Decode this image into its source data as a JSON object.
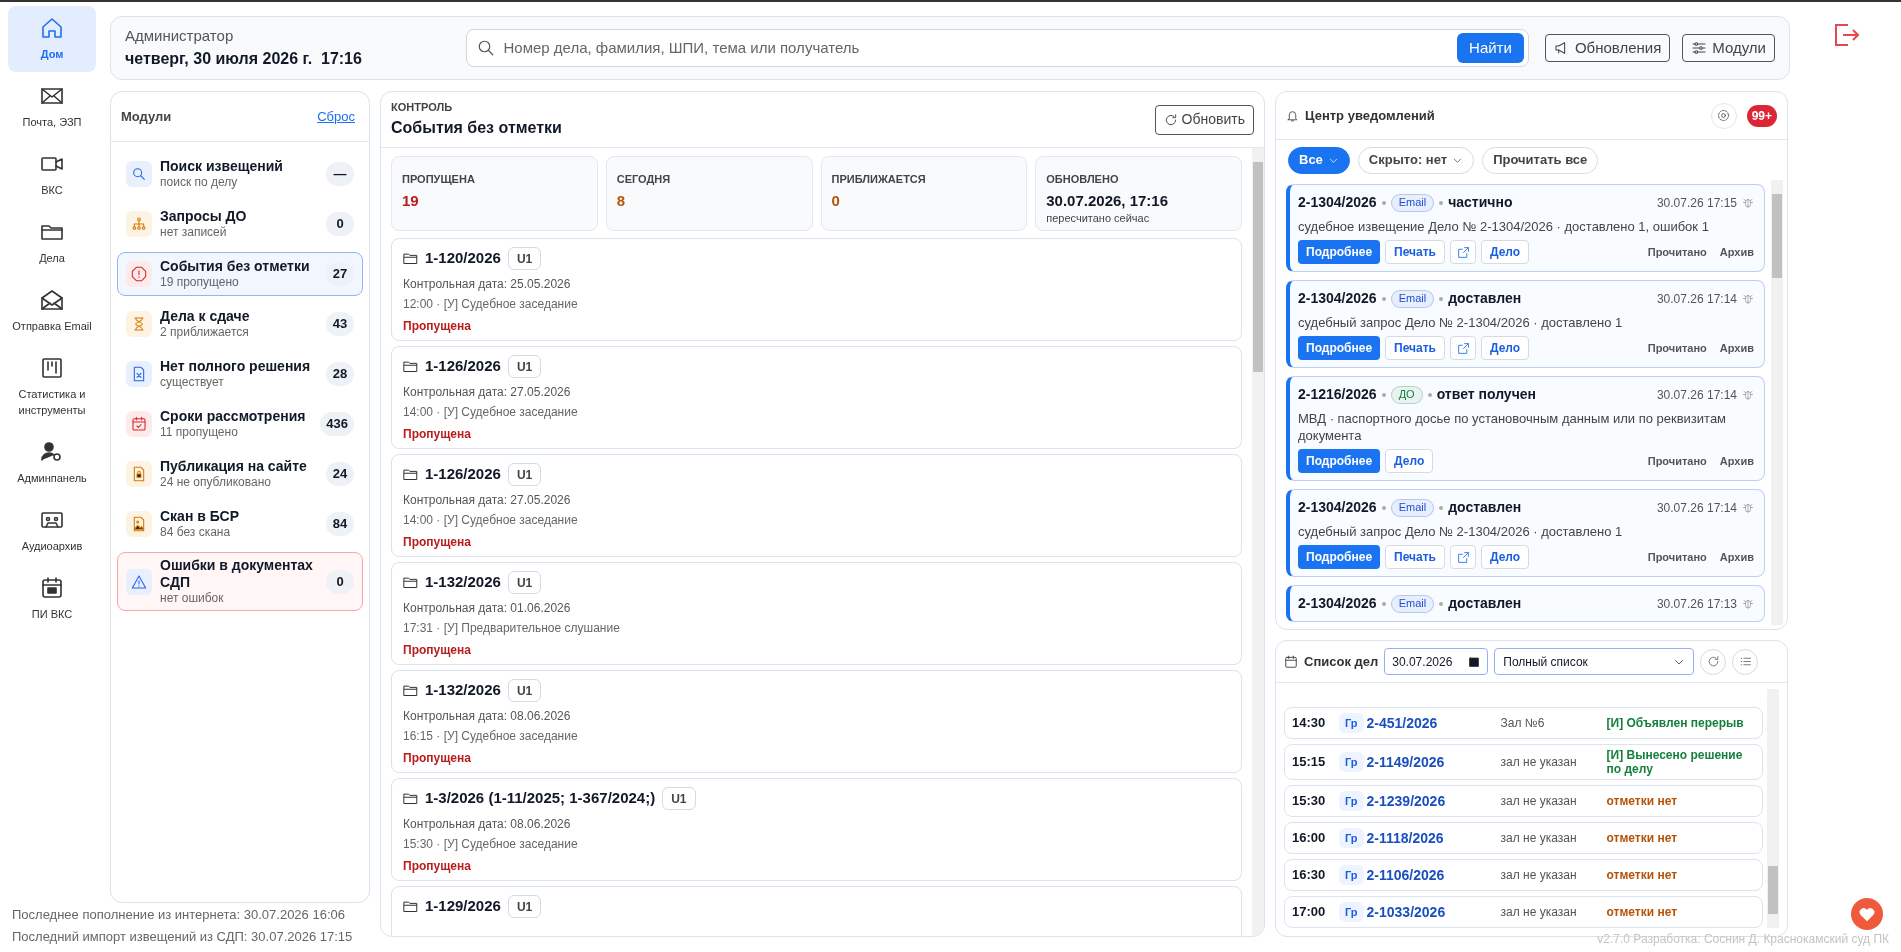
{
  "nav": [
    {
      "label": "Дом",
      "selected": true
    },
    {
      "label": "Почта, ЭЗП",
      "selected": false
    },
    {
      "label": "ВКС",
      "selected": false
    },
    {
      "label": "Дела",
      "selected": false
    },
    {
      "label": "Отправка Email",
      "selected": false
    },
    {
      "label": "Статистика и инструменты",
      "selected": false
    },
    {
      "label": "Админпанель",
      "selected": false
    },
    {
      "label": "Аудиоархив",
      "selected": false
    },
    {
      "label": "ПИ ВКС",
      "selected": false
    }
  ],
  "header": {
    "user": "Администратор",
    "datetime": "четверг, 30 июля 2026 г.  17:16",
    "search_placeholder": "Номер дела, фамилия, ШПИ, тема или получатель",
    "search_button": "Найти",
    "buttons": [
      "Обновления",
      "Модули"
    ]
  },
  "modules": {
    "title": "Модули",
    "reset": "Сброс",
    "items": [
      {
        "title": "Поиск извещений",
        "subtitle": "поиск по делу",
        "count": "—",
        "selected": false,
        "alert": false
      },
      {
        "title": "Запросы ДО",
        "subtitle": "нет записей",
        "count": "0",
        "selected": false,
        "alert": false
      },
      {
        "title": "События без отметки",
        "subtitle": "19 пропущено",
        "count": "27",
        "selected": true,
        "alert": false
      },
      {
        "title": "Дела к сдаче",
        "subtitle": "2 приближается",
        "count": "43",
        "selected": false,
        "alert": false
      },
      {
        "title": "Нет полного решения",
        "subtitle": "существует",
        "count": "28",
        "selected": false,
        "alert": false
      },
      {
        "title": "Сроки рассмотрения",
        "subtitle": "11 пропущено",
        "count": "436",
        "selected": false,
        "alert": false
      },
      {
        "title": "Публикация на сайте",
        "subtitle": "24 не опубликовано",
        "count": "24",
        "selected": false,
        "alert": false
      },
      {
        "title": "Скан в БСР",
        "subtitle": "84 без скана",
        "count": "84",
        "selected": false,
        "alert": false
      },
      {
        "title": "Ошибки в документах СДП",
        "subtitle": "нет ошибок",
        "count": "0",
        "selected": false,
        "alert": true
      }
    ]
  },
  "control": {
    "overline": "КОНТРОЛЬ",
    "title": "События без отметки",
    "refresh": "Обновить",
    "stats": [
      {
        "label": "ПРОПУЩЕНА",
        "value": "19",
        "color": "#b91c1c"
      },
      {
        "label": "СЕГОДНЯ",
        "value": "8",
        "color": "#b45309"
      },
      {
        "label": "ПРИБЛИЖАЕТСЯ",
        "value": "0",
        "color": "#b45309"
      },
      {
        "label": "ОБНОВЛЕНО",
        "value": "30.07.2026, 17:16",
        "color": "#111827",
        "note": "пересчитано сейчас"
      }
    ],
    "events": [
      {
        "case": "1-120/2026",
        "tag": "U1",
        "control_date": "Контрольная дата: 25.05.2026",
        "details": "12:00 · [У] Судебное заседание",
        "status": "Пропущена"
      },
      {
        "case": "1-126/2026",
        "tag": "U1",
        "control_date": "Контрольная дата: 27.05.2026",
        "details": "14:00 · [У] Судебное заседание",
        "status": "Пропущена"
      },
      {
        "case": "1-126/2026",
        "tag": "U1",
        "control_date": "Контрольная дата: 27.05.2026",
        "details": "14:00 · [У] Судебное заседание",
        "status": "Пропущена"
      },
      {
        "case": "1-132/2026",
        "tag": "U1",
        "control_date": "Контрольная дата: 01.06.2026",
        "details": "17:31 · [У] Предварительное слушание",
        "status": "Пропущена"
      },
      {
        "case": "1-132/2026",
        "tag": "U1",
        "control_date": "Контрольная дата: 08.06.2026",
        "details": "16:15 · [У] Судебное заседание",
        "status": "Пропущена"
      },
      {
        "case": "1-3/2026 (1-11/2025; 1-367/2024;)",
        "tag": "U1",
        "control_date": "Контрольная дата: 08.06.2026",
        "details": "15:30 · [У] Судебное заседание",
        "status": "Пропущена"
      },
      {
        "case": "1-129/2026",
        "tag": "U1"
      }
    ]
  },
  "notifications": {
    "title": "Центр уведомлений",
    "badge": "99+",
    "filters": [
      {
        "label": "Все",
        "selected": true,
        "dropdown": true
      },
      {
        "label": "Скрыто: нет",
        "selected": false,
        "dropdown": true
      },
      {
        "label": "Прочитать все",
        "selected": false,
        "dropdown": false
      }
    ],
    "items": [
      {
        "case": "2-1304/2026",
        "channel": "Email",
        "color": "#1d4ed8",
        "status": "частично",
        "time": "30.07.26 17:15",
        "text": "судебное извещение Дело № 2-1304/2026 · доставлено 1, ошибок 1",
        "actions": [
          {
            "kind": "primary",
            "label": "Подробнее"
          },
          {
            "kind": "outline",
            "label": "Печать"
          },
          {
            "kind": "icon"
          },
          {
            "kind": "outline",
            "label": "Дело"
          }
        ],
        "links": [
          "Прочитано",
          "Архив"
        ]
      },
      {
        "case": "2-1304/2026",
        "channel": "Email",
        "color": "#1d4ed8",
        "status": "доставлен",
        "time": "30.07.26 17:14",
        "text": "судебный запрос Дело № 2-1304/2026 · доставлено 1",
        "actions": [
          {
            "kind": "primary",
            "label": "Подробнее"
          },
          {
            "kind": "outline",
            "label": "Печать"
          },
          {
            "kind": "icon"
          },
          {
            "kind": "outline",
            "label": "Дело"
          }
        ],
        "links": [
          "Прочитано",
          "Архив"
        ]
      },
      {
        "case": "2-1216/2026",
        "channel": "ДО",
        "color": "#15803d",
        "status": "ответ получен",
        "time": "30.07.26 17:14",
        "text": "МВД · паспортного досье по установочным данным или по реквизитам документа",
        "actions": [
          {
            "kind": "primary",
            "label": "Подробнее"
          },
          {
            "kind": "outline",
            "label": "Дело"
          }
        ],
        "links": [
          "Прочитано",
          "Архив"
        ]
      },
      {
        "case": "2-1304/2026",
        "channel": "Email",
        "color": "#1d4ed8",
        "status": "доставлен",
        "time": "30.07.26 17:14",
        "text": "судебный запрос Дело № 2-1304/2026 · доставлено 1",
        "actions": [
          {
            "kind": "primary",
            "label": "Подробнее"
          },
          {
            "kind": "outline",
            "label": "Печать"
          },
          {
            "kind": "icon"
          },
          {
            "kind": "outline",
            "label": "Дело"
          }
        ],
        "links": [
          "Прочитано",
          "Архив"
        ]
      },
      {
        "case": "2-1304/2026",
        "channel": "Email",
        "color": "#1d4ed8",
        "status": "доставлен",
        "time": "30.07.26 17:13"
      }
    ]
  },
  "case_list": {
    "title": "Список дел",
    "date": "30.07.2026",
    "view": "Полный список",
    "rows": [
      {
        "time": "14:30",
        "type": "Гр",
        "case": "2-451/2026",
        "room": "Зал №6",
        "status": "[И] Объявлен перерыв",
        "color": "#15803d"
      },
      {
        "time": "15:15",
        "type": "Гр",
        "case": "2-1149/2026",
        "room": "зал не указан",
        "status": "[И] Вынесено решение по делу",
        "color": "#15803d"
      },
      {
        "time": "15:30",
        "type": "Гр",
        "case": "2-1239/2026",
        "room": "зал не указан",
        "status": "отметки нет",
        "color": "#b45309"
      },
      {
        "time": "16:00",
        "type": "Гр",
        "case": "2-1118/2026",
        "room": "зал не указан",
        "status": "отметки нет",
        "color": "#b45309"
      },
      {
        "time": "16:30",
        "type": "Гр",
        "case": "2-1106/2026",
        "room": "зал не указан",
        "status": "отметки нет",
        "color": "#b45309"
      },
      {
        "time": "17:00",
        "type": "Гр",
        "case": "2-1033/2026",
        "room": "зал не указан",
        "status": "отметки нет",
        "color": "#b45309"
      }
    ]
  },
  "footer": {
    "lines": [
      "Последнее пополнение из интернета: 30.07.2026 16:06",
      "Последний импорт извещений из СДП: 30.07.2026 17:15"
    ],
    "version": "v2.7.0 Разработка: Соснин Д. Краснокамский суд ПК"
  }
}
